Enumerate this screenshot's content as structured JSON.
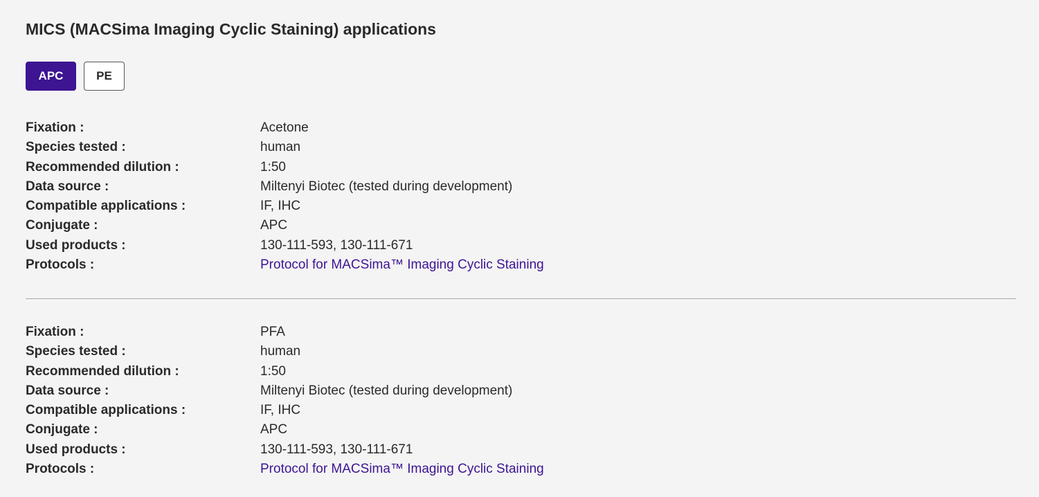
{
  "header": {
    "title": "MICS (MACSima Imaging Cyclic Staining) applications"
  },
  "tabs": [
    {
      "label": "APC",
      "active": true
    },
    {
      "label": "PE",
      "active": false
    }
  ],
  "colors": {
    "accent": "#3d1492",
    "background": "#f4f4f4",
    "text": "#2a2a2a",
    "divider": "#a8a8a8"
  },
  "sections": [
    {
      "rows": [
        {
          "label": "Fixation :",
          "value": "Acetone"
        },
        {
          "label": "Species tested :",
          "value": "human"
        },
        {
          "label": "Recommended dilution :",
          "value": "1:50"
        },
        {
          "label": "Data source :",
          "value": "Miltenyi Biotec (tested during development)"
        },
        {
          "label": "Compatible applications :",
          "value": "IF, IHC"
        },
        {
          "label": "Conjugate :",
          "value": "APC"
        },
        {
          "label": "Used products :",
          "value": "130-111-593, 130-111-671"
        },
        {
          "label": "Protocols :",
          "value": "Protocol for MACSima™ Imaging Cyclic Staining"
        }
      ]
    },
    {
      "rows": [
        {
          "label": "Fixation :",
          "value": "PFA"
        },
        {
          "label": "Species tested :",
          "value": "human"
        },
        {
          "label": "Recommended dilution :",
          "value": "1:50"
        },
        {
          "label": "Data source :",
          "value": "Miltenyi Biotec (tested during development)"
        },
        {
          "label": "Compatible applications :",
          "value": "IF, IHC"
        },
        {
          "label": "Conjugate :",
          "value": "APC"
        },
        {
          "label": "Used products :",
          "value": "130-111-593, 130-111-671"
        },
        {
          "label": "Protocols :",
          "value": "Protocol for MACSima™ Imaging Cyclic Staining"
        }
      ]
    }
  ]
}
